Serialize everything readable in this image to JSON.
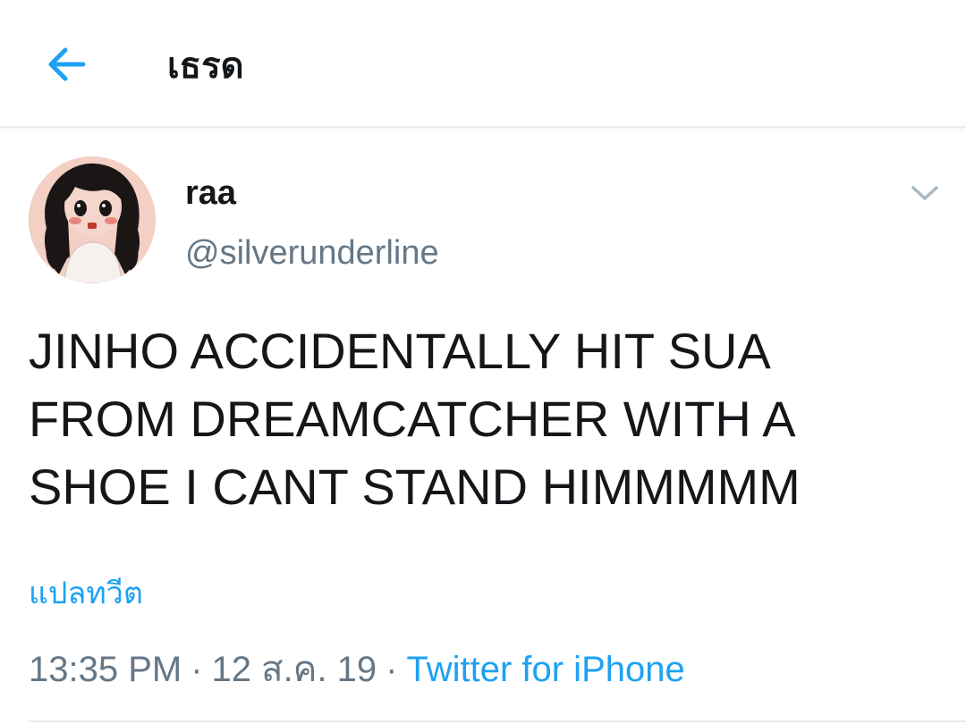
{
  "header": {
    "title": "เธรด",
    "back_icon": "arrow-left-icon",
    "accent_color": "#1da1f2"
  },
  "tweet": {
    "display_name": "raa",
    "handle": "@silverunderline",
    "caret_icon": "chevron-down-icon",
    "text": "JINHO ACCIDENTALLY HIT SUA\nFROM DREAMCATCHER WITH A\nSHOE I CANT STAND HIMMMMM",
    "translate_label": "แปลทวีต",
    "time": "13:35 PM",
    "date": "12 ส.ค. 19",
    "separator": "·",
    "source": "Twitter for iPhone"
  }
}
